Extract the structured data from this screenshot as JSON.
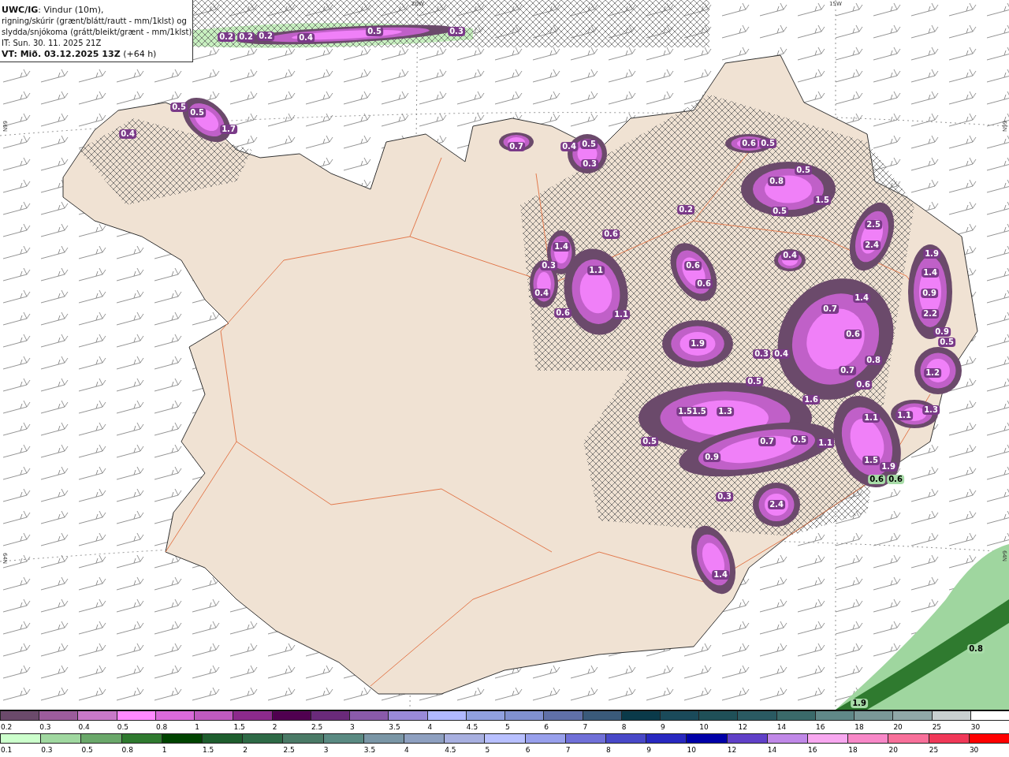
{
  "title_box": {
    "lines": [
      "**UWC/IG**: Vindur (10m),",
      "rigning/skúrir (grænt/blátt/rautt - mm/1klst) og",
      "slydda/snjókoma (grátt/bleikt/grænt - mm/1klst)",
      "IT: Sun. 30. 11. 2025 21Z",
      "**VT: Mið. 03.12.2025 13Z** (+64 h)"
    ]
  },
  "map": {
    "axis_labels": [
      "20W",
      "15W",
      "66N",
      "66N",
      "64N",
      "64N"
    ],
    "value_labels": [
      {
        "text": "0.2",
        "kind": "snow"
      },
      {
        "text": "0.2",
        "kind": "snow"
      },
      {
        "text": "0.2",
        "kind": "snow"
      },
      {
        "text": "0.4",
        "kind": "snow"
      },
      {
        "text": "0.5",
        "kind": "snow"
      },
      {
        "text": "0.3",
        "kind": "snow"
      },
      {
        "text": "0.5",
        "kind": "snow"
      },
      {
        "text": "0.5",
        "kind": "snow"
      },
      {
        "text": "0.4",
        "kind": "snow"
      },
      {
        "text": "1.7",
        "kind": "snow"
      },
      {
        "text": "0.7",
        "kind": "snow"
      },
      {
        "text": "0.4",
        "kind": "snow"
      },
      {
        "text": "0.5",
        "kind": "snow"
      },
      {
        "text": "0.6",
        "kind": "snow"
      },
      {
        "text": "0.5",
        "kind": "snow"
      },
      {
        "text": "0.3",
        "kind": "snow"
      },
      {
        "text": "0.5",
        "kind": "snow"
      },
      {
        "text": "0.8",
        "kind": "snow"
      },
      {
        "text": "1.5",
        "kind": "snow"
      },
      {
        "text": "0.2",
        "kind": "snow"
      },
      {
        "text": "0.5",
        "kind": "snow"
      },
      {
        "text": "2.5",
        "kind": "snow"
      },
      {
        "text": "0.6",
        "kind": "snow"
      },
      {
        "text": "1.4",
        "kind": "snow"
      },
      {
        "text": "2.4",
        "kind": "snow"
      },
      {
        "text": "0.4",
        "kind": "snow"
      },
      {
        "text": "1.9",
        "kind": "snow"
      },
      {
        "text": "0.3",
        "kind": "snow"
      },
      {
        "text": "1.1",
        "kind": "snow"
      },
      {
        "text": "0.6",
        "kind": "snow"
      },
      {
        "text": "1.4",
        "kind": "snow"
      },
      {
        "text": "0.6",
        "kind": "snow"
      },
      {
        "text": "0.4",
        "kind": "snow"
      },
      {
        "text": "1.4",
        "kind": "snow"
      },
      {
        "text": "0.9",
        "kind": "snow"
      },
      {
        "text": "0.6",
        "kind": "snow"
      },
      {
        "text": "1.1",
        "kind": "snow"
      },
      {
        "text": "0.7",
        "kind": "snow"
      },
      {
        "text": "2.2",
        "kind": "snow"
      },
      {
        "text": "0.6",
        "kind": "snow"
      },
      {
        "text": "0.9",
        "kind": "snow"
      },
      {
        "text": "1.9",
        "kind": "snow"
      },
      {
        "text": "0.5",
        "kind": "snow"
      },
      {
        "text": "0.3",
        "kind": "snow"
      },
      {
        "text": "0.4",
        "kind": "snow"
      },
      {
        "text": "0.8",
        "kind": "snow"
      },
      {
        "text": "0.7",
        "kind": "snow"
      },
      {
        "text": "1.2",
        "kind": "snow"
      },
      {
        "text": "0.5",
        "kind": "snow"
      },
      {
        "text": "0.6",
        "kind": "snow"
      },
      {
        "text": "1.6",
        "kind": "snow"
      },
      {
        "text": "1.51.5",
        "kind": "snow"
      },
      {
        "text": "1.3",
        "kind": "snow"
      },
      {
        "text": "1.1",
        "kind": "snow"
      },
      {
        "text": "1.1",
        "kind": "snow"
      },
      {
        "text": "1.3",
        "kind": "snow"
      },
      {
        "text": "0.5",
        "kind": "snow"
      },
      {
        "text": "0.7",
        "kind": "snow"
      },
      {
        "text": "0.5",
        "kind": "snow"
      },
      {
        "text": "1.1",
        "kind": "snow"
      },
      {
        "text": "0.9",
        "kind": "snow"
      },
      {
        "text": "1.5",
        "kind": "snow"
      },
      {
        "text": "1.9",
        "kind": "snow"
      },
      {
        "text": "0.6",
        "kind": "rain"
      },
      {
        "text": "0.6",
        "kind": "rain"
      },
      {
        "text": "0.3",
        "kind": "snow"
      },
      {
        "text": "2.4",
        "kind": "snow"
      },
      {
        "text": "1.4",
        "kind": "snow"
      },
      {
        "text": "0.8",
        "kind": "rain"
      },
      {
        "text": "1.9",
        "kind": "rain"
      }
    ]
  },
  "legend": {
    "rows": [
      {
        "items": [
          {
            "label": "0.2",
            "color": "#6b4a6b"
          },
          {
            "label": "0.3",
            "color": "#9c5c9c"
          },
          {
            "label": "0.4",
            "color": "#c878c8"
          },
          {
            "label": "0.5",
            "color": "#ff88ff"
          },
          {
            "label": "0.8",
            "color": "#da6ada"
          },
          {
            "label": "1",
            "color": "#c05ac0"
          },
          {
            "label": "1.5",
            "color": "#8c2a8c"
          },
          {
            "label": "2",
            "color": "#500050"
          },
          {
            "label": "2.5",
            "color": "#6a2a7a"
          },
          {
            "label": "3",
            "color": "#8a5aaa"
          },
          {
            "label": "3.5",
            "color": "#9a8ad8"
          },
          {
            "label": "4",
            "color": "#b0b8ff"
          },
          {
            "label": "4.5",
            "color": "#90a0e0"
          },
          {
            "label": "5",
            "color": "#8090d0"
          },
          {
            "label": "6",
            "color": "#6070a8"
          },
          {
            "label": "7",
            "color": "#3a5a7a"
          },
          {
            "label": "8",
            "color": "#0a3a4a"
          },
          {
            "label": "9",
            "color": "#1a4a5a"
          },
          {
            "label": "10",
            "color": "#1f5058"
          },
          {
            "label": "12",
            "color": "#2a5a62"
          },
          {
            "label": "14",
            "color": "#3a6a6a"
          },
          {
            "label": "16",
            "color": "#608888"
          },
          {
            "label": "18",
            "color": "#7a9898"
          },
          {
            "label": "20",
            "color": "#90a8a8"
          },
          {
            "label": "25",
            "color": "#c8d0d0"
          },
          {
            "label": "30",
            "color": "#ffffff"
          }
        ]
      },
      {
        "items": [
          {
            "label": "0.1",
            "color": "#ccffcc"
          },
          {
            "label": "0.3",
            "color": "#a0d8a0"
          },
          {
            "label": "0.5",
            "color": "#6aa86a"
          },
          {
            "label": "0.8",
            "color": "#2f7a2f"
          },
          {
            "label": "1",
            "color": "#004400"
          },
          {
            "label": "1.5",
            "color": "#1e5e2e"
          },
          {
            "label": "2",
            "color": "#2e6a46"
          },
          {
            "label": "2.5",
            "color": "#4a7a66"
          },
          {
            "label": "3",
            "color": "#5a8a82"
          },
          {
            "label": "3.5",
            "color": "#7a96a6"
          },
          {
            "label": "4",
            "color": "#8ea0c0"
          },
          {
            "label": "4.5",
            "color": "#a8b0e0"
          },
          {
            "label": "5",
            "color": "#b8c0ff"
          },
          {
            "label": "6",
            "color": "#98a0ec"
          },
          {
            "label": "7",
            "color": "#7070d8"
          },
          {
            "label": "8",
            "color": "#4848c8"
          },
          {
            "label": "9",
            "color": "#2828c0"
          },
          {
            "label": "10",
            "color": "#0000a8"
          },
          {
            "label": "12",
            "color": "#6040c8"
          },
          {
            "label": "14",
            "color": "#c088e8"
          },
          {
            "label": "16",
            "color": "#f8a8f0"
          },
          {
            "label": "18",
            "color": "#f888c8"
          },
          {
            "label": "20",
            "color": "#f8709a"
          },
          {
            "label": "25",
            "color": "#f03858"
          },
          {
            "label": "30",
            "color": "#ff0000"
          }
        ]
      }
    ]
  }
}
